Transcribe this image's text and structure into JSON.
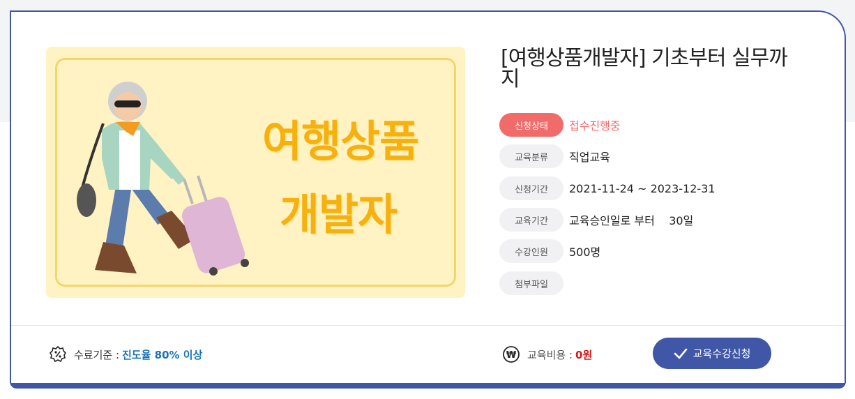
{
  "course": {
    "title": "[여행상품개발자] 기초부터 실무까지",
    "thumbnail_text_line1": "여행상품",
    "thumbnail_text_line2": "개발자"
  },
  "info": {
    "status": {
      "label": "신청상태",
      "value": "접수진행중"
    },
    "category": {
      "label": "교육분류",
      "value": "직업교육"
    },
    "apply_period": {
      "label": "신청기간",
      "value": "2021-11-24 ~ 2023-12-31"
    },
    "edu_period": {
      "label": "교육기간",
      "value": "교육승인일로 부터    30일"
    },
    "capacity": {
      "label": "수강인원",
      "value": "500명"
    },
    "attachment": {
      "label": "첨부파일",
      "value": ""
    }
  },
  "footer": {
    "completion_label": "수료기준 :",
    "completion_value": "진도율 80% 이상",
    "fee_label": "교육비용 :",
    "fee_value": "0원",
    "apply_button": "교육수강신청"
  },
  "colors": {
    "accent": "#3f57a6",
    "status": "#f26b6b",
    "completion": "#1a73b8",
    "fee": "#d31a1a"
  }
}
